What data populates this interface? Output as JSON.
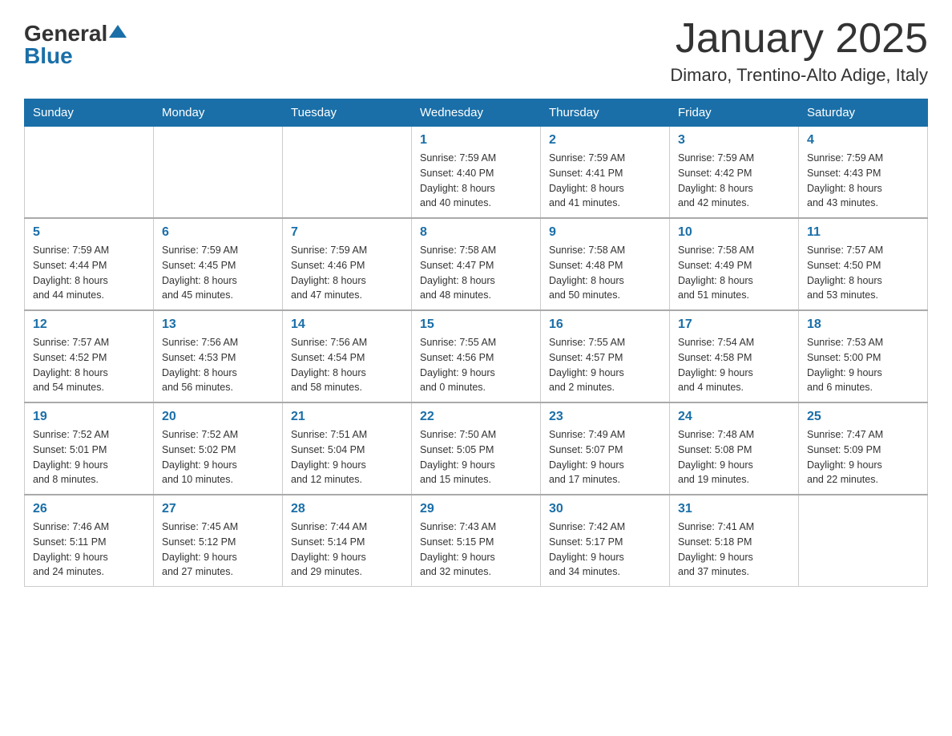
{
  "header": {
    "logo": {
      "general": "General",
      "blue": "Blue"
    },
    "title": "January 2025",
    "location": "Dimaro, Trentino-Alto Adige, Italy"
  },
  "days_of_week": [
    "Sunday",
    "Monday",
    "Tuesday",
    "Wednesday",
    "Thursday",
    "Friday",
    "Saturday"
  ],
  "weeks": [
    [
      {
        "day": "",
        "info": ""
      },
      {
        "day": "",
        "info": ""
      },
      {
        "day": "",
        "info": ""
      },
      {
        "day": "1",
        "info": "Sunrise: 7:59 AM\nSunset: 4:40 PM\nDaylight: 8 hours\nand 40 minutes."
      },
      {
        "day": "2",
        "info": "Sunrise: 7:59 AM\nSunset: 4:41 PM\nDaylight: 8 hours\nand 41 minutes."
      },
      {
        "day": "3",
        "info": "Sunrise: 7:59 AM\nSunset: 4:42 PM\nDaylight: 8 hours\nand 42 minutes."
      },
      {
        "day": "4",
        "info": "Sunrise: 7:59 AM\nSunset: 4:43 PM\nDaylight: 8 hours\nand 43 minutes."
      }
    ],
    [
      {
        "day": "5",
        "info": "Sunrise: 7:59 AM\nSunset: 4:44 PM\nDaylight: 8 hours\nand 44 minutes."
      },
      {
        "day": "6",
        "info": "Sunrise: 7:59 AM\nSunset: 4:45 PM\nDaylight: 8 hours\nand 45 minutes."
      },
      {
        "day": "7",
        "info": "Sunrise: 7:59 AM\nSunset: 4:46 PM\nDaylight: 8 hours\nand 47 minutes."
      },
      {
        "day": "8",
        "info": "Sunrise: 7:58 AM\nSunset: 4:47 PM\nDaylight: 8 hours\nand 48 minutes."
      },
      {
        "day": "9",
        "info": "Sunrise: 7:58 AM\nSunset: 4:48 PM\nDaylight: 8 hours\nand 50 minutes."
      },
      {
        "day": "10",
        "info": "Sunrise: 7:58 AM\nSunset: 4:49 PM\nDaylight: 8 hours\nand 51 minutes."
      },
      {
        "day": "11",
        "info": "Sunrise: 7:57 AM\nSunset: 4:50 PM\nDaylight: 8 hours\nand 53 minutes."
      }
    ],
    [
      {
        "day": "12",
        "info": "Sunrise: 7:57 AM\nSunset: 4:52 PM\nDaylight: 8 hours\nand 54 minutes."
      },
      {
        "day": "13",
        "info": "Sunrise: 7:56 AM\nSunset: 4:53 PM\nDaylight: 8 hours\nand 56 minutes."
      },
      {
        "day": "14",
        "info": "Sunrise: 7:56 AM\nSunset: 4:54 PM\nDaylight: 8 hours\nand 58 minutes."
      },
      {
        "day": "15",
        "info": "Sunrise: 7:55 AM\nSunset: 4:56 PM\nDaylight: 9 hours\nand 0 minutes."
      },
      {
        "day": "16",
        "info": "Sunrise: 7:55 AM\nSunset: 4:57 PM\nDaylight: 9 hours\nand 2 minutes."
      },
      {
        "day": "17",
        "info": "Sunrise: 7:54 AM\nSunset: 4:58 PM\nDaylight: 9 hours\nand 4 minutes."
      },
      {
        "day": "18",
        "info": "Sunrise: 7:53 AM\nSunset: 5:00 PM\nDaylight: 9 hours\nand 6 minutes."
      }
    ],
    [
      {
        "day": "19",
        "info": "Sunrise: 7:52 AM\nSunset: 5:01 PM\nDaylight: 9 hours\nand 8 minutes."
      },
      {
        "day": "20",
        "info": "Sunrise: 7:52 AM\nSunset: 5:02 PM\nDaylight: 9 hours\nand 10 minutes."
      },
      {
        "day": "21",
        "info": "Sunrise: 7:51 AM\nSunset: 5:04 PM\nDaylight: 9 hours\nand 12 minutes."
      },
      {
        "day": "22",
        "info": "Sunrise: 7:50 AM\nSunset: 5:05 PM\nDaylight: 9 hours\nand 15 minutes."
      },
      {
        "day": "23",
        "info": "Sunrise: 7:49 AM\nSunset: 5:07 PM\nDaylight: 9 hours\nand 17 minutes."
      },
      {
        "day": "24",
        "info": "Sunrise: 7:48 AM\nSunset: 5:08 PM\nDaylight: 9 hours\nand 19 minutes."
      },
      {
        "day": "25",
        "info": "Sunrise: 7:47 AM\nSunset: 5:09 PM\nDaylight: 9 hours\nand 22 minutes."
      }
    ],
    [
      {
        "day": "26",
        "info": "Sunrise: 7:46 AM\nSunset: 5:11 PM\nDaylight: 9 hours\nand 24 minutes."
      },
      {
        "day": "27",
        "info": "Sunrise: 7:45 AM\nSunset: 5:12 PM\nDaylight: 9 hours\nand 27 minutes."
      },
      {
        "day": "28",
        "info": "Sunrise: 7:44 AM\nSunset: 5:14 PM\nDaylight: 9 hours\nand 29 minutes."
      },
      {
        "day": "29",
        "info": "Sunrise: 7:43 AM\nSunset: 5:15 PM\nDaylight: 9 hours\nand 32 minutes."
      },
      {
        "day": "30",
        "info": "Sunrise: 7:42 AM\nSunset: 5:17 PM\nDaylight: 9 hours\nand 34 minutes."
      },
      {
        "day": "31",
        "info": "Sunrise: 7:41 AM\nSunset: 5:18 PM\nDaylight: 9 hours\nand 37 minutes."
      },
      {
        "day": "",
        "info": ""
      }
    ]
  ]
}
